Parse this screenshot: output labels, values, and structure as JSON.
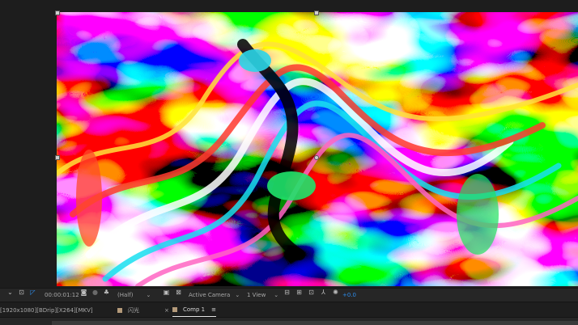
{
  "toolbar": {
    "timecode": "00:00:01:12",
    "resolution": "(Half)",
    "camera": "Active Camera",
    "view": "1 View",
    "exposure": "+0.0"
  },
  "tabs": {
    "footage_label": "[1920x1080][BDrip][X264][MKV]",
    "flash_label": "闪光",
    "comp_label": "Comp 1",
    "close_glyph": "×",
    "menu_glyph": "≡"
  },
  "colors": {
    "accent": "#2d8ceb",
    "tab_swatch": "#b49a7a",
    "panel_bg": "#232323"
  }
}
